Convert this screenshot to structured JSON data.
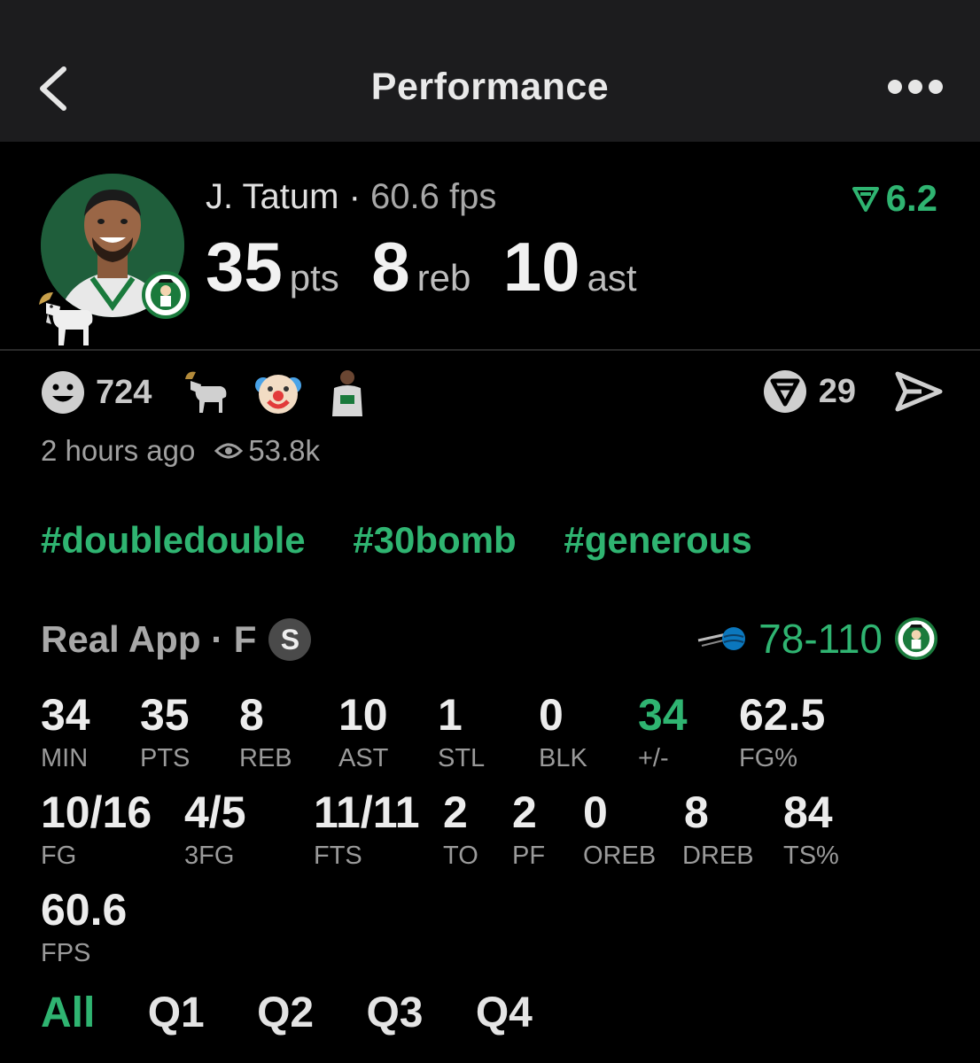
{
  "nav": {
    "title": "Performance"
  },
  "player": {
    "name": "J. Tatum",
    "separator": "·",
    "fps": "60.6 fps",
    "rating": "6.2",
    "pts": "35",
    "pts_label": "pts",
    "reb": "8",
    "reb_label": "reb",
    "ast": "10",
    "ast_label": "ast"
  },
  "reactions": {
    "count": "724",
    "comments": "29"
  },
  "meta": {
    "time": "2 hours ago",
    "views": "53.8k"
  },
  "tags": [
    "#doubledouble",
    "#30bomb",
    "#generous"
  ],
  "game": {
    "source": "Real App · F",
    "badge": "S",
    "score": "78-110"
  },
  "stats_row1": [
    {
      "v": "34",
      "l": "MIN"
    },
    {
      "v": "35",
      "l": "PTS"
    },
    {
      "v": "8",
      "l": "REB"
    },
    {
      "v": "10",
      "l": "AST"
    },
    {
      "v": "1",
      "l": "STL"
    },
    {
      "v": "0",
      "l": "BLK"
    },
    {
      "v": "34",
      "l": "+/-"
    },
    {
      "v": "62.5",
      "l": "FG%"
    }
  ],
  "stats_row2": [
    {
      "v": "10/16",
      "l": "FG"
    },
    {
      "v": "4/5",
      "l": "3FG"
    },
    {
      "v": "11/11",
      "l": "FTS"
    },
    {
      "v": "2",
      "l": "TO"
    },
    {
      "v": "2",
      "l": "PF"
    },
    {
      "v": "0",
      "l": "OREB"
    },
    {
      "v": "8",
      "l": "DREB"
    },
    {
      "v": "84",
      "l": "TS%"
    }
  ],
  "stats_row3": [
    {
      "v": "60.6",
      "l": "FPS"
    }
  ],
  "quarters": [
    "All",
    "Q1",
    "Q2",
    "Q3",
    "Q4"
  ],
  "colors": {
    "accent": "#2fb471",
    "background": "#000000",
    "nav": "#1c1c1e"
  }
}
